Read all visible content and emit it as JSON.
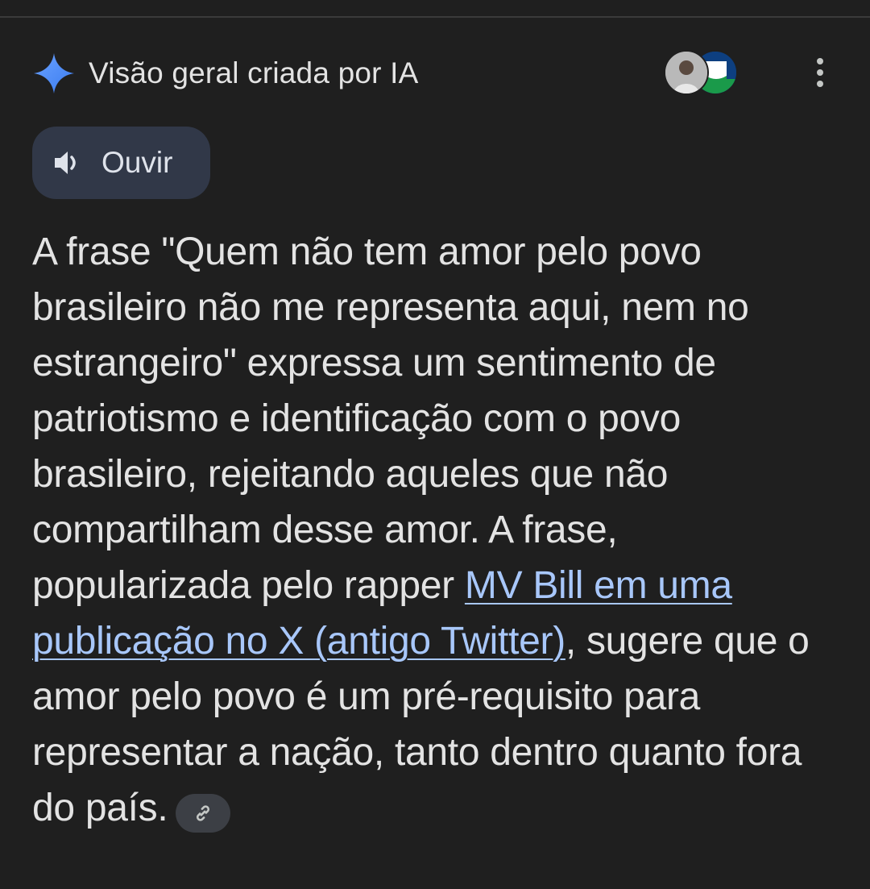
{
  "overview": {
    "title": "Visão geral criada por IA",
    "listen_label": "Ouvir",
    "text_before_link": "A frase \"Quem não tem amor pelo povo brasileiro não me representa aqui, nem no estrangeiro\" expressa um sentimento de patriotismo e identificação com o povo brasileiro, rejeitando aqueles que não compartilham desse amor. A frase, popularizada pelo rapper ",
    "link_text": "MV Bill em uma publicação no X (antigo Twitter)",
    "text_after_link": ", sugere que o amor pelo povo é um pré-requisito para representar a nação, tanto dentro quanto fora do país."
  },
  "icons": {
    "sparkle": "gemini-sparkle-icon",
    "speaker": "speaker-icon",
    "more": "more-vertical-icon",
    "link": "link-icon"
  },
  "colors": {
    "background": "#1f1f1f",
    "text": "#e3e3e3",
    "link": "#a8c7fa",
    "listen_button_bg": "#313848",
    "chip_bg": "#3c3f45",
    "sparkle": "#4e8cf5"
  }
}
